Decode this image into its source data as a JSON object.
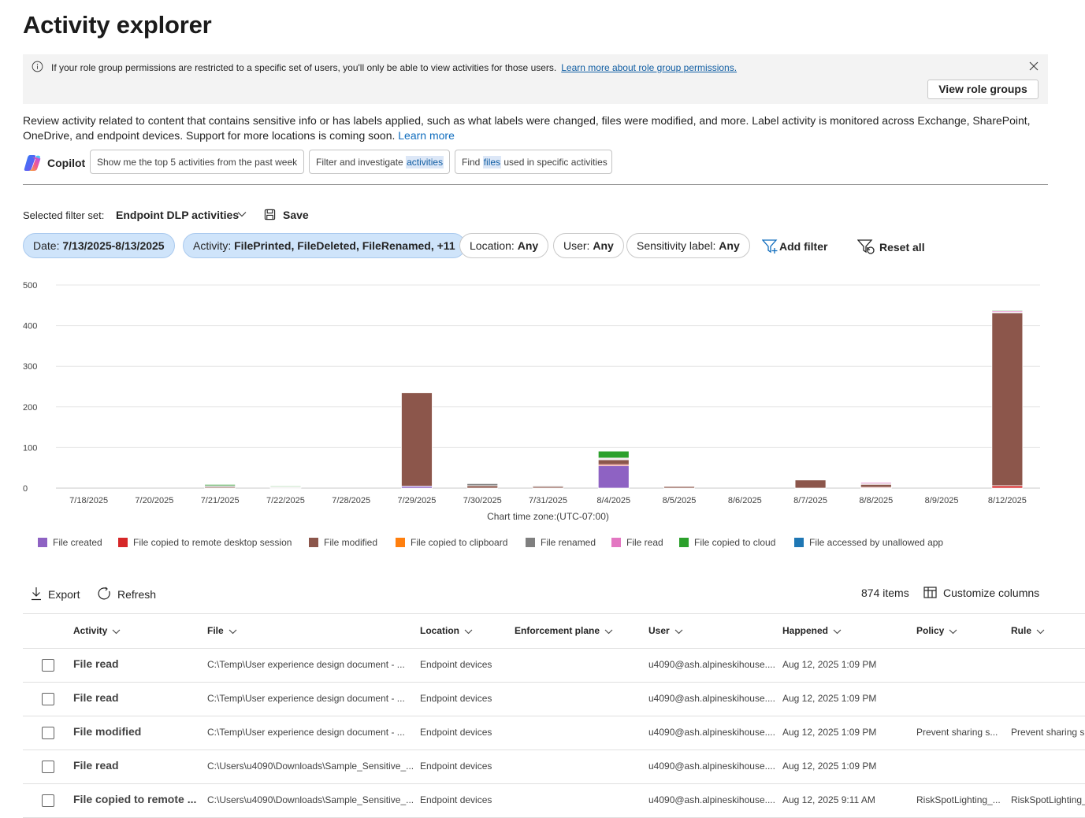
{
  "page_title": "Activity explorer",
  "banner": {
    "message": "If your role group permissions are restricted to a specific set of users, you'll only be able to view activities for those users.",
    "link": "Learn more about role group permissions.",
    "button": "View role groups"
  },
  "description": {
    "text": "Review activity related to content that contains sensitive info or has labels applied, such as what labels were changed, files were modified, and more. Label activity is monitored across Exchange, SharePoint, OneDrive, and endpoint devices. Support for more locations is coming soon.",
    "link": "Learn more"
  },
  "copilot": {
    "label": "Copilot",
    "prompts": [
      {
        "pre": "Show me the top 5 activities from the past week",
        "hl": "",
        "post": ""
      },
      {
        "pre": "Filter and investigate ",
        "hl": "activities",
        "post": ""
      },
      {
        "pre": "Find ",
        "hl": "files",
        "post": " used in specific activities"
      }
    ]
  },
  "filter_set": {
    "label": "Selected filter set:",
    "value": "Endpoint DLP activities",
    "save": "Save"
  },
  "filters": [
    {
      "key": "Date:",
      "value": "7/13/2025-8/13/2025"
    },
    {
      "key": "Activity:",
      "value": "FilePrinted, FileDeleted, FileRenamed, +11"
    },
    {
      "key": "Location:",
      "value": "Any"
    },
    {
      "key": "User:",
      "value": "Any"
    },
    {
      "key": "Sensitivity label:",
      "value": "Any"
    }
  ],
  "add_filter": "Add filter",
  "reset_all": "Reset all",
  "chart_data": {
    "type": "bar",
    "stacked": true,
    "categories": [
      "7/18/2025",
      "7/20/2025",
      "7/21/2025",
      "7/22/2025",
      "7/28/2025",
      "7/29/2025",
      "7/30/2025",
      "7/31/2025",
      "8/4/2025",
      "8/5/2025",
      "8/6/2025",
      "8/7/2025",
      "8/8/2025",
      "8/9/2025",
      "8/12/2025"
    ],
    "ylim": [
      0,
      500
    ],
    "yticks": [
      "500",
      "400",
      "300",
      "200",
      "100",
      "0"
    ],
    "xlabel": "Chart time zone:(UTC-07:00)",
    "legend_position": "bottom",
    "grid": true,
    "series": [
      {
        "name": "File created",
        "color": "#8e62c3",
        "values": [
          0,
          0,
          0,
          0,
          0,
          5,
          0,
          0,
          55,
          0,
          0,
          0,
          0,
          0,
          0
        ]
      },
      {
        "name": "File copied to remote desktop session",
        "color": "#d62728",
        "values": [
          0,
          0,
          0,
          0,
          0,
          0,
          0,
          0,
          3,
          0,
          0,
          0,
          2,
          0,
          6
        ]
      },
      {
        "name": "File modified",
        "color": "#8c564b",
        "values": [
          0,
          0,
          3,
          2,
          0,
          230,
          6,
          4,
          12,
          4,
          0,
          20,
          8,
          0,
          425
        ]
      },
      {
        "name": "File copied to clipboard",
        "color": "#ff7f0e",
        "values": [
          0,
          0,
          0,
          0,
          0,
          0,
          0,
          0,
          0,
          0,
          0,
          0,
          0,
          0,
          0
        ]
      },
      {
        "name": "File renamed",
        "color": "#7f7f7f",
        "values": [
          0,
          0,
          3,
          1,
          0,
          0,
          5,
          2,
          2,
          0,
          0,
          0,
          1,
          0,
          2
        ]
      },
      {
        "name": "File read",
        "color": "#e377c2",
        "values": [
          0,
          0,
          0,
          0,
          0,
          0,
          0,
          0,
          2,
          0,
          0,
          0,
          3,
          0,
          4
        ]
      },
      {
        "name": "File copied to cloud",
        "color": "#2ca02c",
        "values": [
          0,
          0,
          3,
          2,
          0,
          0,
          0,
          0,
          17,
          0,
          0,
          0,
          0,
          0,
          1
        ]
      },
      {
        "name": "File accessed by unallowed app",
        "color": "#1f77b4",
        "values": [
          0,
          0,
          0,
          0,
          0,
          0,
          0,
          0,
          0,
          0,
          0,
          0,
          0,
          0,
          0
        ]
      }
    ]
  },
  "table_toolbar": {
    "export": "Export",
    "refresh": "Refresh",
    "count": "874 items",
    "customize": "Customize columns"
  },
  "table": {
    "columns": [
      "Activity",
      "File",
      "Location",
      "Enforcement plane",
      "User",
      "Happened",
      "Policy",
      "Rule"
    ],
    "rows": [
      {
        "activity": "File read",
        "file": "C:\\Temp\\User experience design document - ...",
        "location": "Endpoint devices",
        "plane": "",
        "user": "u4090@ash.alpineskihouse....",
        "happened": "Aug 12, 2025 1:09 PM",
        "policy": "",
        "rule": ""
      },
      {
        "activity": "File read",
        "file": "C:\\Temp\\User experience design document - ...",
        "location": "Endpoint devices",
        "plane": "",
        "user": "u4090@ash.alpineskihouse....",
        "happened": "Aug 12, 2025 1:09 PM",
        "policy": "",
        "rule": ""
      },
      {
        "activity": "File modified",
        "file": "C:\\Temp\\User experience design document - ...",
        "location": "Endpoint devices",
        "plane": "",
        "user": "u4090@ash.alpineskihouse....",
        "happened": "Aug 12, 2025 1:09 PM",
        "policy": "Prevent sharing s...",
        "rule": "Prevent sharing s..."
      },
      {
        "activity": "File read",
        "file": "C:\\Users\\u4090\\Downloads\\Sample_Sensitive_...",
        "location": "Endpoint devices",
        "plane": "",
        "user": "u4090@ash.alpineskihouse....",
        "happened": "Aug 12, 2025 1:09 PM",
        "policy": "",
        "rule": ""
      },
      {
        "activity": "File copied to remote ...",
        "file": "C:\\Users\\u4090\\Downloads\\Sample_Sensitive_...",
        "location": "Endpoint devices",
        "plane": "",
        "user": "u4090@ash.alpineskihouse....",
        "happened": "Aug 12, 2025 9:11 AM",
        "policy": "RiskSpotLighting_...",
        "rule": "RiskSpotLighting_..."
      }
    ]
  }
}
